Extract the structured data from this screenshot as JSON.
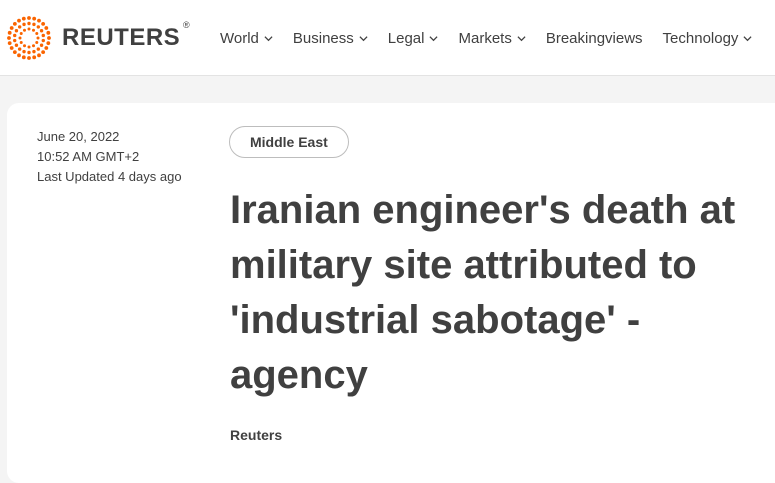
{
  "brand": {
    "name": "REUTERS",
    "registered_mark": "®",
    "logo_icon": "reuters-dot-circle-logo",
    "accent_color": "#fa6400"
  },
  "nav": {
    "items": [
      {
        "label": "World",
        "has_dropdown": true
      },
      {
        "label": "Business",
        "has_dropdown": true
      },
      {
        "label": "Legal",
        "has_dropdown": true
      },
      {
        "label": "Markets",
        "has_dropdown": true
      },
      {
        "label": "Breakingviews",
        "has_dropdown": false
      },
      {
        "label": "Technology",
        "has_dropdown": true
      }
    ],
    "dropdown_icon": "chevron-down-icon"
  },
  "article": {
    "date": "June 20, 2022",
    "time": "10:52 AM GMT+2",
    "last_updated": "Last Updated 4 days ago",
    "section_tag": "Middle East",
    "headline": "Iranian engineer's death at military site attributed to 'industrial sabotage' - agency",
    "byline": "Reuters"
  },
  "colors": {
    "text": "#404040",
    "page_background": "#f4f4f4",
    "card_background": "#ffffff"
  }
}
